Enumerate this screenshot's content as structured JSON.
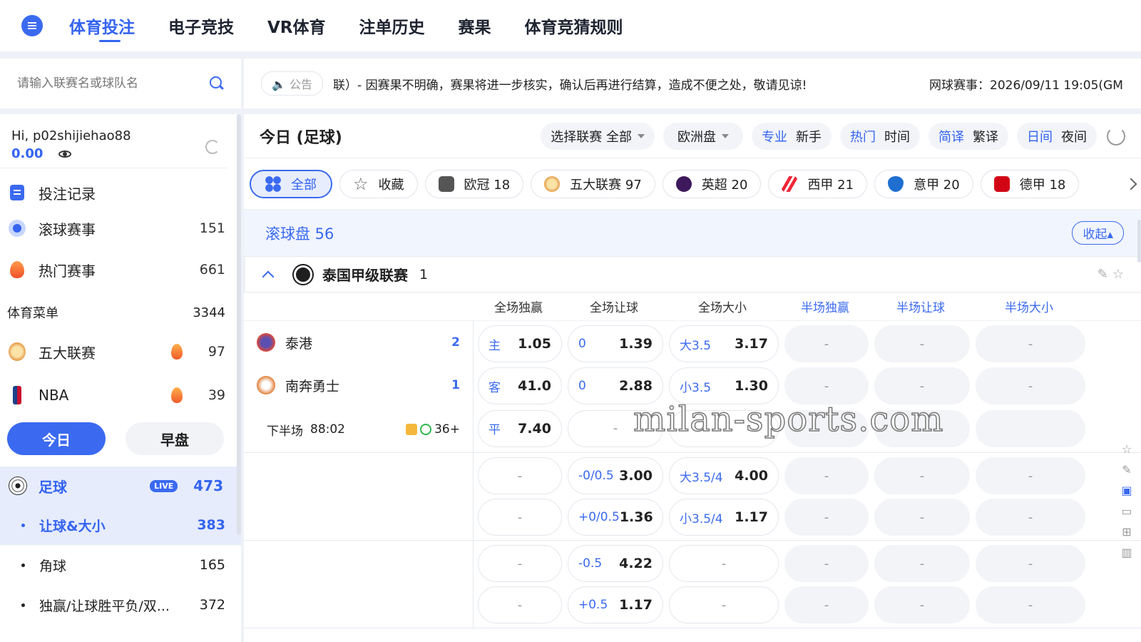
{
  "nav": {
    "items": [
      {
        "label": "体育投注",
        "active": true
      },
      {
        "label": "电子竞技",
        "active": false
      },
      {
        "label": "VR体育",
        "active": false
      },
      {
        "label": "注单历史",
        "active": false
      },
      {
        "label": "赛果",
        "active": false
      },
      {
        "label": "体育竞猜规则",
        "active": false
      }
    ]
  },
  "search": {
    "placeholder": "请输入联赛名或球队名"
  },
  "notice": {
    "label": "公告",
    "text": "联）- 因赛果不明确，赛果将进一步核实，确认后再进行结算，造成不便之处，敬请见谅!",
    "time": "网球赛事：2026/09/11 19:05(GM"
  },
  "user": {
    "greeting": "Hi, p02shijiehao88",
    "balance": "0.00"
  },
  "sidebar": {
    "record": "投注记录",
    "live": {
      "label": "滚球赛事",
      "count": "151"
    },
    "hot": {
      "label": "热门赛事",
      "count": "661"
    },
    "menu": {
      "label": "体育菜单",
      "count": "3344"
    },
    "five": {
      "label": "五大联赛",
      "count": "97"
    },
    "nba": {
      "label": "NBA",
      "count": "39"
    },
    "tab_today": "今日",
    "tab_early": "早盘",
    "soccer": {
      "label": "足球",
      "live": "LIVE",
      "count": "473"
    },
    "subs": [
      {
        "label": "让球&大小",
        "count": "383"
      },
      {
        "label": "角球",
        "count": "165"
      },
      {
        "label": "独赢/让球胜平负/双...",
        "count": "372"
      }
    ]
  },
  "toolbar": {
    "title": "今日 (足球)",
    "league_select": "选择联赛  全部",
    "odds_type": "欧洲盘",
    "toggles": [
      {
        "on": "专业",
        "off": "新手"
      },
      {
        "on": "热门",
        "off": "时间"
      },
      {
        "on": "简译",
        "off": "繁译"
      },
      {
        "on": "日间",
        "off": "夜间"
      }
    ]
  },
  "chips": [
    {
      "label": "全部"
    },
    {
      "label": "收藏"
    },
    {
      "label": "欧冠 18"
    },
    {
      "label": "五大联赛 97"
    },
    {
      "label": "英超 20"
    },
    {
      "label": "西甲 21"
    },
    {
      "label": "意甲 20"
    },
    {
      "label": "德甲 18"
    }
  ],
  "section": {
    "title": "滚球盘 56",
    "collapse": "收起▴"
  },
  "league": {
    "name": "泰国甲级联赛",
    "count": "1"
  },
  "columns": [
    "全场独赢",
    "全场让球",
    "全场大小",
    "半场独赢",
    "半场让球",
    "半场大小"
  ],
  "match": {
    "home": {
      "name": "泰港",
      "score": "2"
    },
    "away": {
      "name": "南奔勇士",
      "score": "1"
    },
    "period": "下半场",
    "clock": "88:02",
    "more": "36+"
  },
  "odds": {
    "rows1": [
      [
        {
          "k": "主",
          "v": "1.05"
        },
        {
          "k": "0",
          "v": "1.39"
        },
        {
          "k": "大3.5",
          "v": "3.17"
        }
      ],
      [
        {
          "k": "客",
          "v": "41.0"
        },
        {
          "k": "0",
          "v": "2.88"
        },
        {
          "k": "小3.5",
          "v": "1.30"
        }
      ],
      [
        {
          "k": "平",
          "v": "7.40"
        },
        {
          "k": "",
          "v": "-"
        },
        {
          "k": "",
          "v": ""
        }
      ]
    ],
    "rows2": [
      [
        {
          "k": "",
          "v": "-"
        },
        {
          "k": "-0/0.5",
          "v": "3.00"
        },
        {
          "k": "大3.5/4",
          "v": "4.00"
        }
      ],
      [
        {
          "k": "",
          "v": "-"
        },
        {
          "k": "+0/0.5",
          "v": "1.36"
        },
        {
          "k": "小3.5/4",
          "v": "1.17"
        }
      ]
    ],
    "rows3": [
      [
        {
          "k": "",
          "v": "-"
        },
        {
          "k": "-0.5",
          "v": "4.22"
        },
        {
          "k": "",
          "v": "-"
        }
      ],
      [
        {
          "k": "",
          "v": "-"
        },
        {
          "k": "+0.5",
          "v": "1.17"
        },
        {
          "k": "",
          "v": "-"
        }
      ]
    ],
    "dash": "-"
  },
  "watermark": "milan-sports.com"
}
